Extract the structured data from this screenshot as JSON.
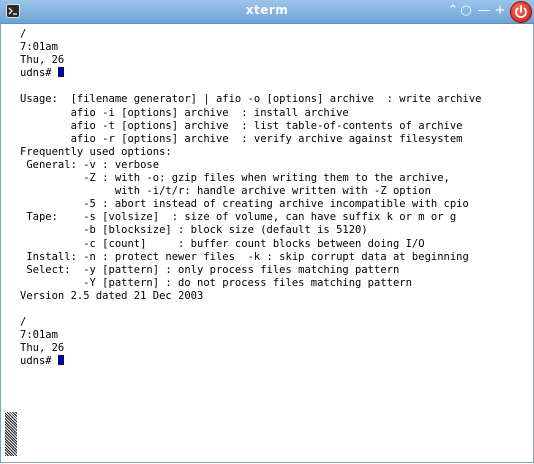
{
  "window": {
    "title": "xterm"
  },
  "titlebar_buttons": [
    {
      "name": "shade-button",
      "glyph": "⌃",
      "icon": "chevron-up-icon"
    },
    {
      "name": "sticky-button",
      "glyph": "○",
      "icon": "circle-icon"
    },
    {
      "name": "minimize-button",
      "glyph": "—",
      "icon": "minimize-icon"
    },
    {
      "name": "maximize-button",
      "glyph": "+",
      "icon": "plus-icon"
    }
  ],
  "terminal": {
    "lines": [
      "/",
      "7:01am",
      "Thu, 26",
      "udns# ",
      "",
      "Usage:  [filename generator] | afio -o [options] archive  : write archive",
      "        afio -i [options] archive  : install archive",
      "        afio -t [options] archive  : list table-of-contents of archive",
      "        afio -r [options] archive  : verify archive against filesystem",
      "Frequently used options:",
      " General: -v : verbose",
      "          -Z : with -o: gzip files when writing them to the archive,",
      "               with -i/t/r: handle archive written with -Z option",
      "          -5 : abort instead of creating archive incompatible with cpio",
      " Tape:    -s [volsize]  : size of volume, can have suffix k or m or g",
      "          -b [blocksize] : block size (default is 5120)",
      "          -c [count]     : buffer count blocks between doing I/O",
      " Install: -n : protect newer files  -k : skip corrupt data at beginning",
      " Select:  -y [pattern] : only process files matching pattern",
      "          -Y [pattern] : do not process files matching pattern",
      "Version 2.5 dated 21 Dec 2003",
      "",
      "/",
      "7:01am",
      "Thu, 26",
      "udns# "
    ],
    "cursor_lines": [
      3,
      25
    ]
  },
  "colors": {
    "titlebar": "#6ea3d6",
    "cursor": "#00008b",
    "power": "#c21a10"
  }
}
